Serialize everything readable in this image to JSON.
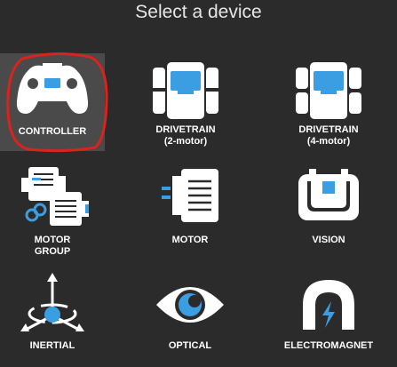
{
  "header": {
    "title": "Select a device"
  },
  "devices": [
    {
      "id": "controller",
      "line1": "CONTROLLER",
      "line2": "",
      "icon": "controller-icon",
      "selected": true
    },
    {
      "id": "drivetrain-2",
      "line1": "DRIVETRAIN",
      "line2": "(2-motor)",
      "icon": "drivetrain-2-motor-icon"
    },
    {
      "id": "drivetrain-4",
      "line1": "DRIVETRAIN",
      "line2": "(4-motor)",
      "icon": "drivetrain-4-motor-icon"
    },
    {
      "id": "motor-group",
      "line1": "MOTOR",
      "line2": "GROUP",
      "icon": "motor-group-icon"
    },
    {
      "id": "motor",
      "line1": "MOTOR",
      "line2": "",
      "icon": "motor-icon"
    },
    {
      "id": "vision",
      "line1": "VISION",
      "line2": "",
      "icon": "vision-sensor-icon"
    },
    {
      "id": "inertial",
      "line1": "INERTIAL",
      "line2": "",
      "icon": "inertial-sensor-icon"
    },
    {
      "id": "optical",
      "line1": "OPTICAL",
      "line2": "",
      "icon": "optical-sensor-icon"
    },
    {
      "id": "electromagnet",
      "line1": "ELECTROMAGNET",
      "line2": "",
      "icon": "electromagnet-icon"
    }
  ],
  "colors": {
    "accent": "#3b9ee3",
    "background": "#2b2b2b",
    "selected_bg": "#4a4a4a",
    "annotation": "#d9231c"
  }
}
